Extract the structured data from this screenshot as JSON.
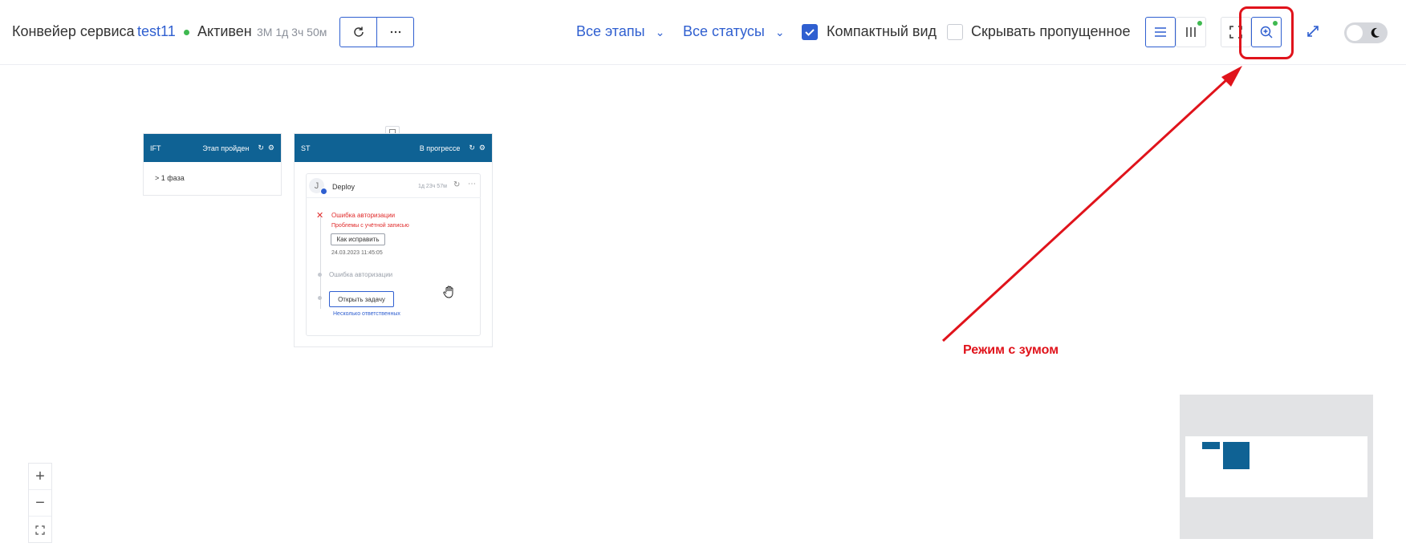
{
  "header": {
    "title": "Конвейер сервиса",
    "service_link": "test11",
    "status": "Активен",
    "duration": "3М 1д 3ч 50м",
    "refresh_icon": "refresh-icon",
    "more_icon": "more-icon",
    "filters": {
      "stages": "Все этапы",
      "statuses": "Все статусы"
    },
    "compact_view": {
      "label": "Компактный вид",
      "checked": true
    },
    "hide_skipped": {
      "label": "Скрывать пропущенное",
      "checked": false
    },
    "view_modes": [
      "list-view-icon",
      "columns-view-icon",
      "fit-screen-icon",
      "zoom-mode-icon",
      "expand-icon"
    ],
    "theme_toggle": "dark-mode-toggle",
    "accent_color": "#2f5fd0",
    "status_color": "#3fb950"
  },
  "canvas": {
    "stages": [
      {
        "name": "IFT",
        "status": "Этап пройден",
        "phase": "> 1 фаза"
      },
      {
        "name": "ST",
        "status": "В прогрессе",
        "job": {
          "avatar": "J",
          "name": "Deploy",
          "time": "1д 23ч 57м",
          "error_title": "Ошибка авторизации",
          "error_sub": "Проблемы с учётной записью",
          "fix_button": "Как исправить",
          "timestamp": "24.03.2023 11:45:05",
          "step2": "Ошибка авторизации",
          "open_task_button": "Открыть задачу",
          "responsible": "Несколько ответственных"
        }
      }
    ],
    "stage_color": "#0f6294"
  },
  "zoom_controls": [
    "+",
    "−",
    "⛶"
  ],
  "annotation": {
    "text": "Режим с зумом",
    "color": "#e0131b"
  }
}
